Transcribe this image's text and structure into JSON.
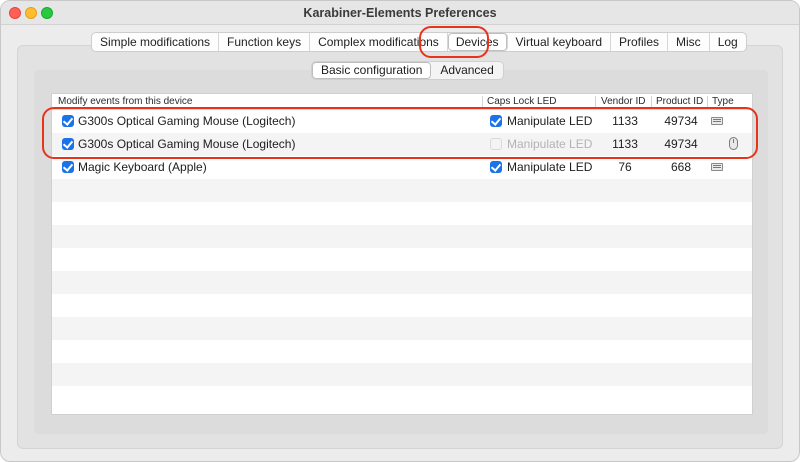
{
  "window": {
    "title": "Karabiner-Elements Preferences"
  },
  "tabs": [
    {
      "label": "Simple modifications"
    },
    {
      "label": "Function keys"
    },
    {
      "label": "Complex modifications"
    },
    {
      "label": "Devices",
      "active": true
    },
    {
      "label": "Virtual keyboard"
    },
    {
      "label": "Profiles"
    },
    {
      "label": "Misc"
    },
    {
      "label": "Log"
    }
  ],
  "subtabs": [
    {
      "label": "Basic configuration",
      "active": true
    },
    {
      "label": "Advanced"
    }
  ],
  "table": {
    "headers": {
      "modify": "Modify events from this device",
      "caps": "Caps Lock LED",
      "vendor": "Vendor ID",
      "product": "Product ID",
      "type": "Type"
    },
    "rows": [
      {
        "device": "G300s Optical Gaming Mouse (Logitech)",
        "modify_checked": true,
        "caps_label": "Manipulate LED",
        "caps_checked": true,
        "caps_enabled": true,
        "vendor_id": "1133",
        "product_id": "49734",
        "type_icon": "keyboard-icon"
      },
      {
        "device": "G300s Optical Gaming Mouse (Logitech)",
        "modify_checked": true,
        "caps_label": "Manipulate LED",
        "caps_checked": false,
        "caps_enabled": false,
        "vendor_id": "1133",
        "product_id": "49734",
        "type_icon": "mouse-icon"
      },
      {
        "device": "Magic Keyboard (Apple)",
        "modify_checked": true,
        "caps_label": "Manipulate LED",
        "caps_checked": true,
        "caps_enabled": true,
        "vendor_id": "76",
        "product_id": "668",
        "type_icon": "keyboard-icon"
      }
    ]
  },
  "colors": {
    "accent": "#1a73e8",
    "annotation": "#e8331b",
    "alt_row": "#f4f4f4"
  }
}
